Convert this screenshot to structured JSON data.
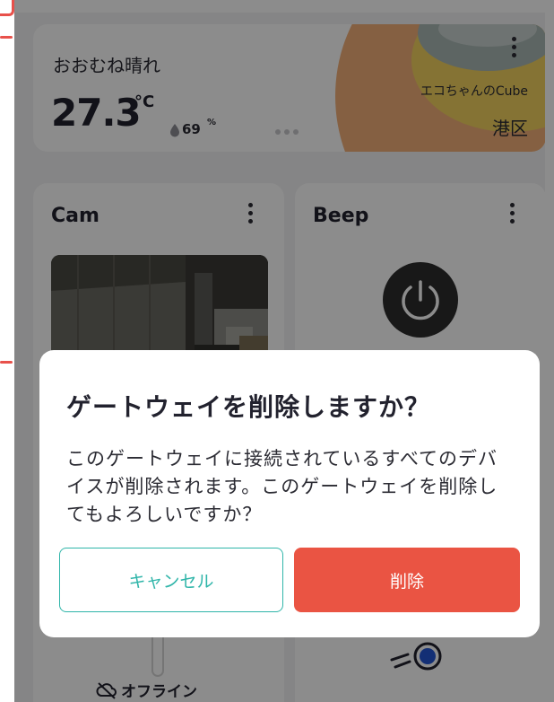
{
  "weather": {
    "condition": "おおむね晴れ",
    "temperature": "27.3",
    "temperature_unit": "°C",
    "humidity": "69",
    "humidity_unit": "%",
    "device_name": "エコちゃんのCube",
    "location": "港区",
    "menu_icon": "more-vertical-icon",
    "humidity_icon": "drop-icon"
  },
  "cards": {
    "cam": {
      "title": "Cam",
      "menu_icon": "more-vertical-icon"
    },
    "beep": {
      "title": "Beep",
      "menu_icon": "more-vertical-icon",
      "power_icon": "power-icon"
    },
    "offline": {
      "label": "オフライン",
      "icon": "cloud-off-icon"
    },
    "signal_icon": "signal-icon"
  },
  "dialog": {
    "title": "ゲートウェイを削除しますか？",
    "message": "このゲートウェイに接続されているすべてのデバイスが削除されます。このゲートウェイを削除してもよろしいですか？",
    "cancel_label": "キャンセル",
    "delete_label": "削除"
  },
  "colors": {
    "accent": "#2fb5a9",
    "danger": "#ea5443",
    "text": "#22222e"
  }
}
